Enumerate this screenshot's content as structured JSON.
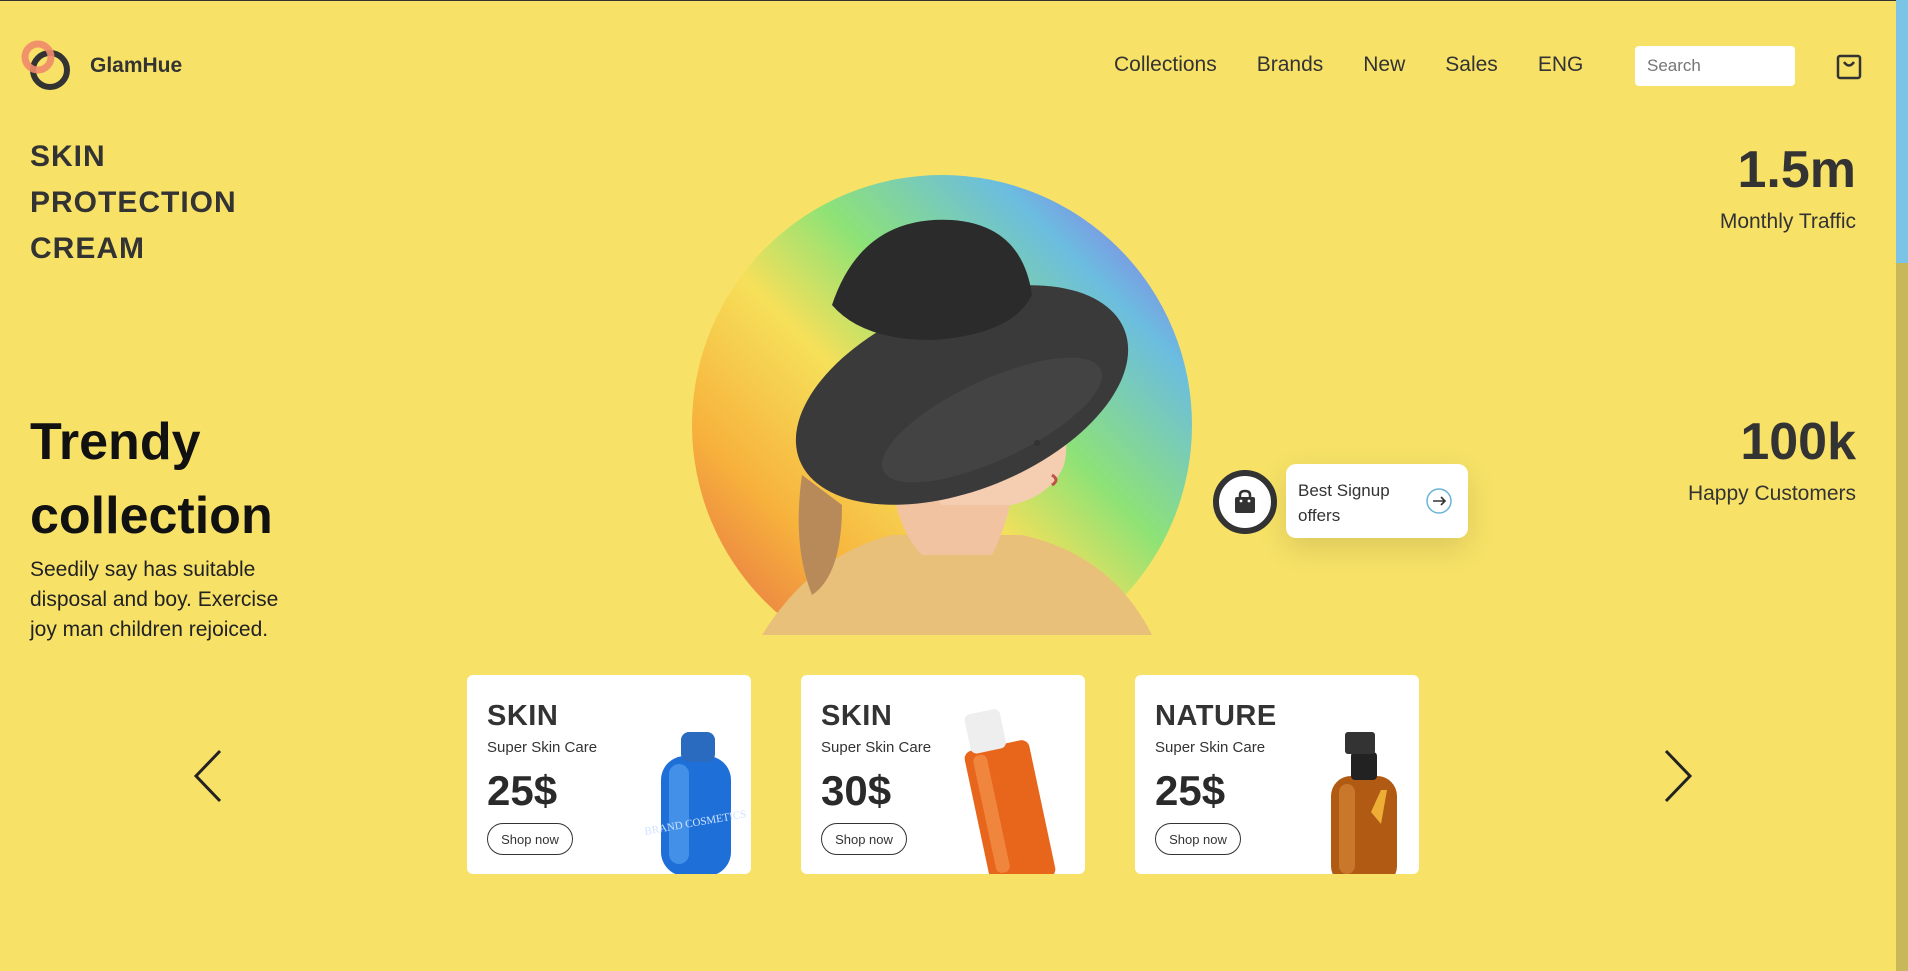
{
  "brand": {
    "name": "GlamHue"
  },
  "nav": {
    "items": [
      "Collections",
      "Brands",
      "New",
      "Sales",
      "ENG"
    ]
  },
  "search": {
    "placeholder": "Search"
  },
  "hero": {
    "product_lines": [
      "SKIN",
      "PROTECTION",
      "CREAM"
    ],
    "headline_lines": [
      "Trendy",
      "collection"
    ],
    "description": "Seedily say has suitable disposal and boy. Exercise joy man children rejoiced."
  },
  "stats": [
    {
      "value": "1.5m",
      "label": "Monthly Traffic"
    },
    {
      "value": "100k",
      "label": "Happy Customers"
    }
  ],
  "signup": {
    "text": "Best Signup offers"
  },
  "products": [
    {
      "category": "SKIN",
      "subtitle": "Super Skin Care",
      "price": "25$",
      "button": "Shop now",
      "bottle_label": "BRAND COSMETICS"
    },
    {
      "category": "SKIN",
      "subtitle": "Super Skin Care",
      "price": "30$",
      "button": "Shop now"
    },
    {
      "category": "NATURE",
      "subtitle": "Super Skin Care",
      "price": "25$",
      "button": "Shop now"
    }
  ],
  "colors": {
    "background": "#f7e267",
    "text": "#2a2a2a",
    "accent_logo": "#f08b6a",
    "scrollbar_thumb": "#7cc4e6"
  },
  "icons": [
    "logo-rings-icon",
    "cart-icon",
    "shopping-bag-icon",
    "arrow-right-icon",
    "chevron-left-icon",
    "chevron-right-icon"
  ]
}
